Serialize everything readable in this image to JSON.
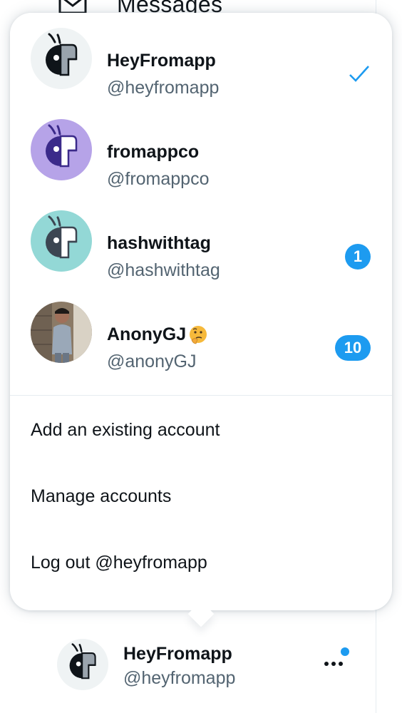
{
  "background_nav": {
    "label": "Messages",
    "icon": "envelope-icon"
  },
  "accounts": [
    {
      "name": "HeyFromapp",
      "handle": "@heyfromapp",
      "avatar": "robot-avatar-gray",
      "selected": true,
      "badge": ""
    },
    {
      "name": "fromappco",
      "handle": "@fromappco",
      "avatar": "robot-avatar-purple",
      "selected": false,
      "badge": ""
    },
    {
      "name": "hashwithtag",
      "handle": "@hashwithtag",
      "avatar": "robot-avatar-teal",
      "selected": false,
      "badge": "1"
    },
    {
      "name": "AnonyGJ",
      "handle": "@anonyGJ",
      "avatar": "photo-avatar-child",
      "selected": false,
      "badge": "10",
      "emoji": "thinking-face"
    }
  ],
  "menu": [
    {
      "label": "Add an existing account"
    },
    {
      "label": "Manage accounts"
    },
    {
      "label": "Log out @heyfromapp"
    }
  ],
  "footer": {
    "name": "HeyFromapp",
    "handle": "@heyfromapp",
    "more_icon": "more-horizontal-icon",
    "notification_dot": true
  },
  "colors": {
    "accent": "#1d9bf0",
    "secondary_text": "#536471",
    "purple": "#b6a3e8",
    "teal": "#93d8d6",
    "gray": "#eff3f4"
  }
}
